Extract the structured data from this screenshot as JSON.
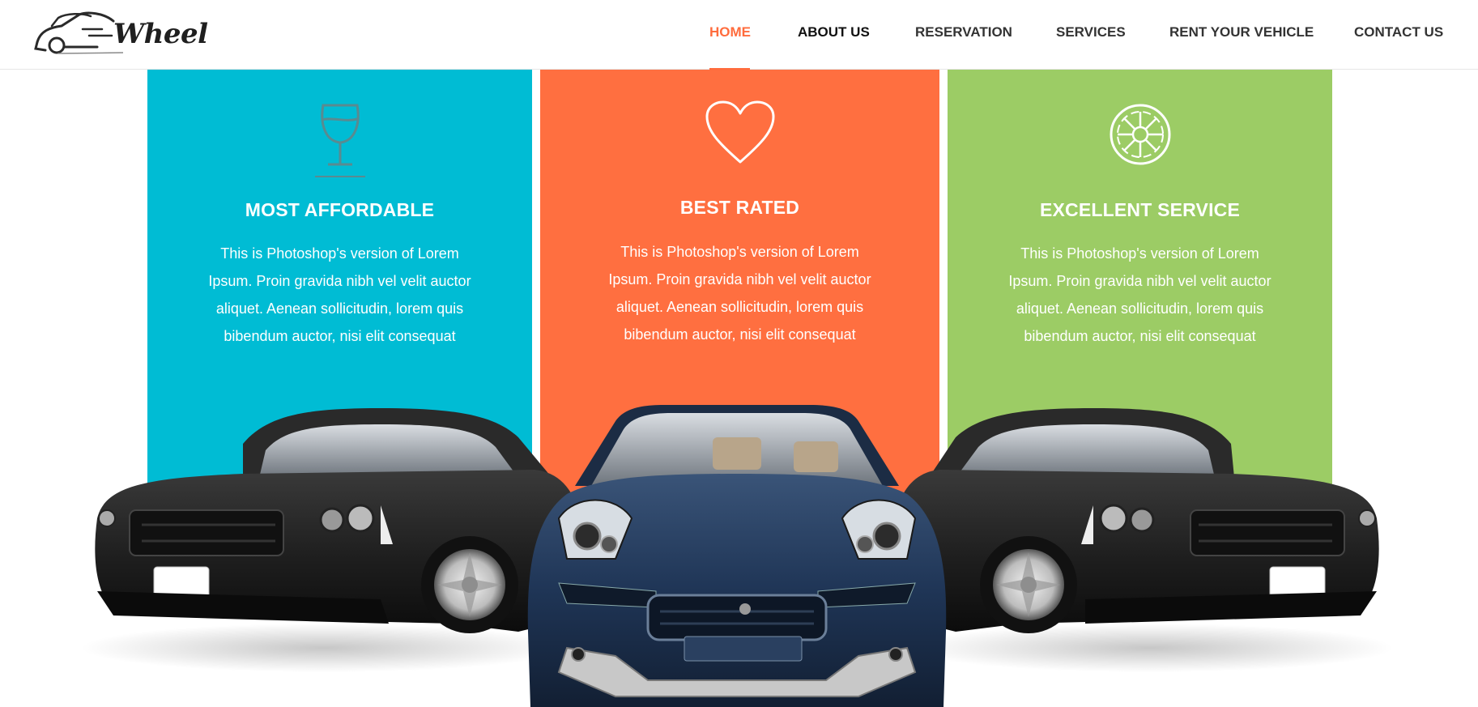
{
  "brand": {
    "name": "Wheel",
    "icon": "car-outline-logo-icon"
  },
  "nav": {
    "items": [
      {
        "label": "HOME"
      },
      {
        "label": "ABOUT US"
      },
      {
        "label": "RESERVATION"
      },
      {
        "label": "SERVICES"
      },
      {
        "label": "RENT YOUR VEHICLE"
      },
      {
        "label": "CONTACT US"
      }
    ],
    "active_index": 0
  },
  "features": [
    {
      "title": "MOST AFFORDABLE",
      "body_lines": [
        "This is Photoshop's version of Lorem",
        "Ipsum. Proin gravida nibh vel velit auctor",
        "aliquet. Aenean sollicitudin, lorem quis",
        "bibendum auctor, nisi elit consequat"
      ],
      "icon": "wine-glass-icon",
      "color": "#00bcd4"
    },
    {
      "title": "BEST RATED",
      "body_lines": [
        "This is Photoshop's version of Lorem",
        "Ipsum. Proin gravida nibh vel velit auctor",
        "aliquet. Aenean sollicitudin, lorem quis",
        "bibendum auctor, nisi elit consequat"
      ],
      "icon": "heart-icon",
      "color": "#ff6f40"
    },
    {
      "title": "EXCELLENT SERVICE",
      "body_lines": [
        "This is Photoshop's version of Lorem",
        "Ipsum. Proin gravida nibh vel velit auctor",
        "aliquet. Aenean sollicitudin, lorem quis",
        "bibendum auctor, nisi elit consequat"
      ],
      "icon": "wheel-icon",
      "color": "#9ccc65"
    }
  ],
  "colors": {
    "accent": "#ff6c3d",
    "nav_text": "#333333"
  }
}
